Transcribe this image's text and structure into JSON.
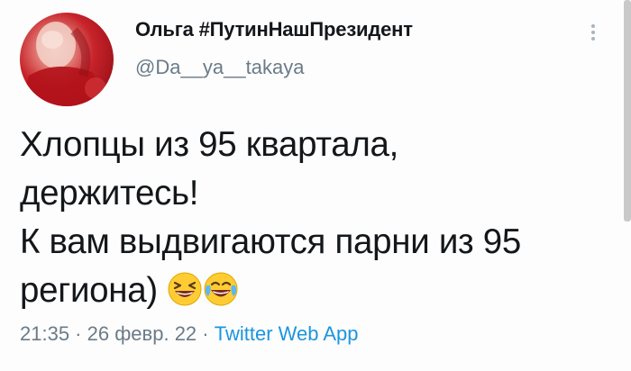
{
  "author": {
    "display_name": "Ольга #ПутинНашПрезидент",
    "handle": "@Da__ya__takaya",
    "avatar_icon": "profile-photo"
  },
  "tweet": {
    "lines": [
      "Хлопцы из 95 квартала,",
      "держитесь!",
      "К вам выдвигаются парни из 95",
      "региона)"
    ],
    "emojis": [
      "squinting-laughing-face-emoji",
      "face-with-tears-of-joy-emoji"
    ]
  },
  "meta": {
    "time": "21:35",
    "separator": " · ",
    "date": "26 февр. 22",
    "app": "Twitter Web App",
    "link_color": "#1b95e0"
  },
  "more_menu_icon": "vertical-ellipsis-icon"
}
